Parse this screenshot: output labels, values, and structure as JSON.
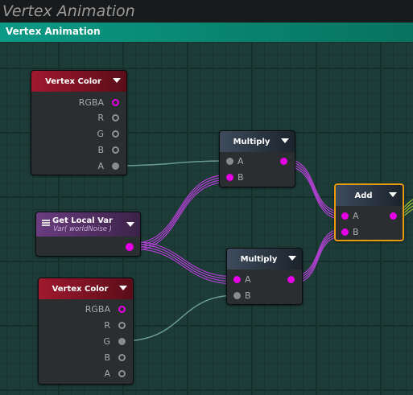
{
  "window": {
    "title": "Vertex Animation",
    "graph_title": "Vertex Animation"
  },
  "nodes": {
    "vertex_color_1": {
      "title": "Vertex Color",
      "ports": [
        "RGBA",
        "R",
        "G",
        "B",
        "A"
      ]
    },
    "multiply_1": {
      "title": "Multiply",
      "inputs": [
        "A",
        "B"
      ]
    },
    "get_local_var": {
      "title": "Get Local Var",
      "subtitle": "Var( worldNoise )"
    },
    "multiply_2": {
      "title": "Multiply",
      "inputs": [
        "A",
        "B"
      ]
    },
    "add": {
      "title": "Add",
      "inputs": [
        "A",
        "B"
      ]
    },
    "vertex_color_2": {
      "title": "Vertex Color",
      "ports": [
        "RGBA",
        "R",
        "G",
        "B",
        "A"
      ]
    }
  },
  "colors": {
    "accent_teal": "#0a9a86",
    "selection": "#e89a10",
    "port_vector": "#e600e6",
    "port_scalar": "#8a8a8a"
  }
}
